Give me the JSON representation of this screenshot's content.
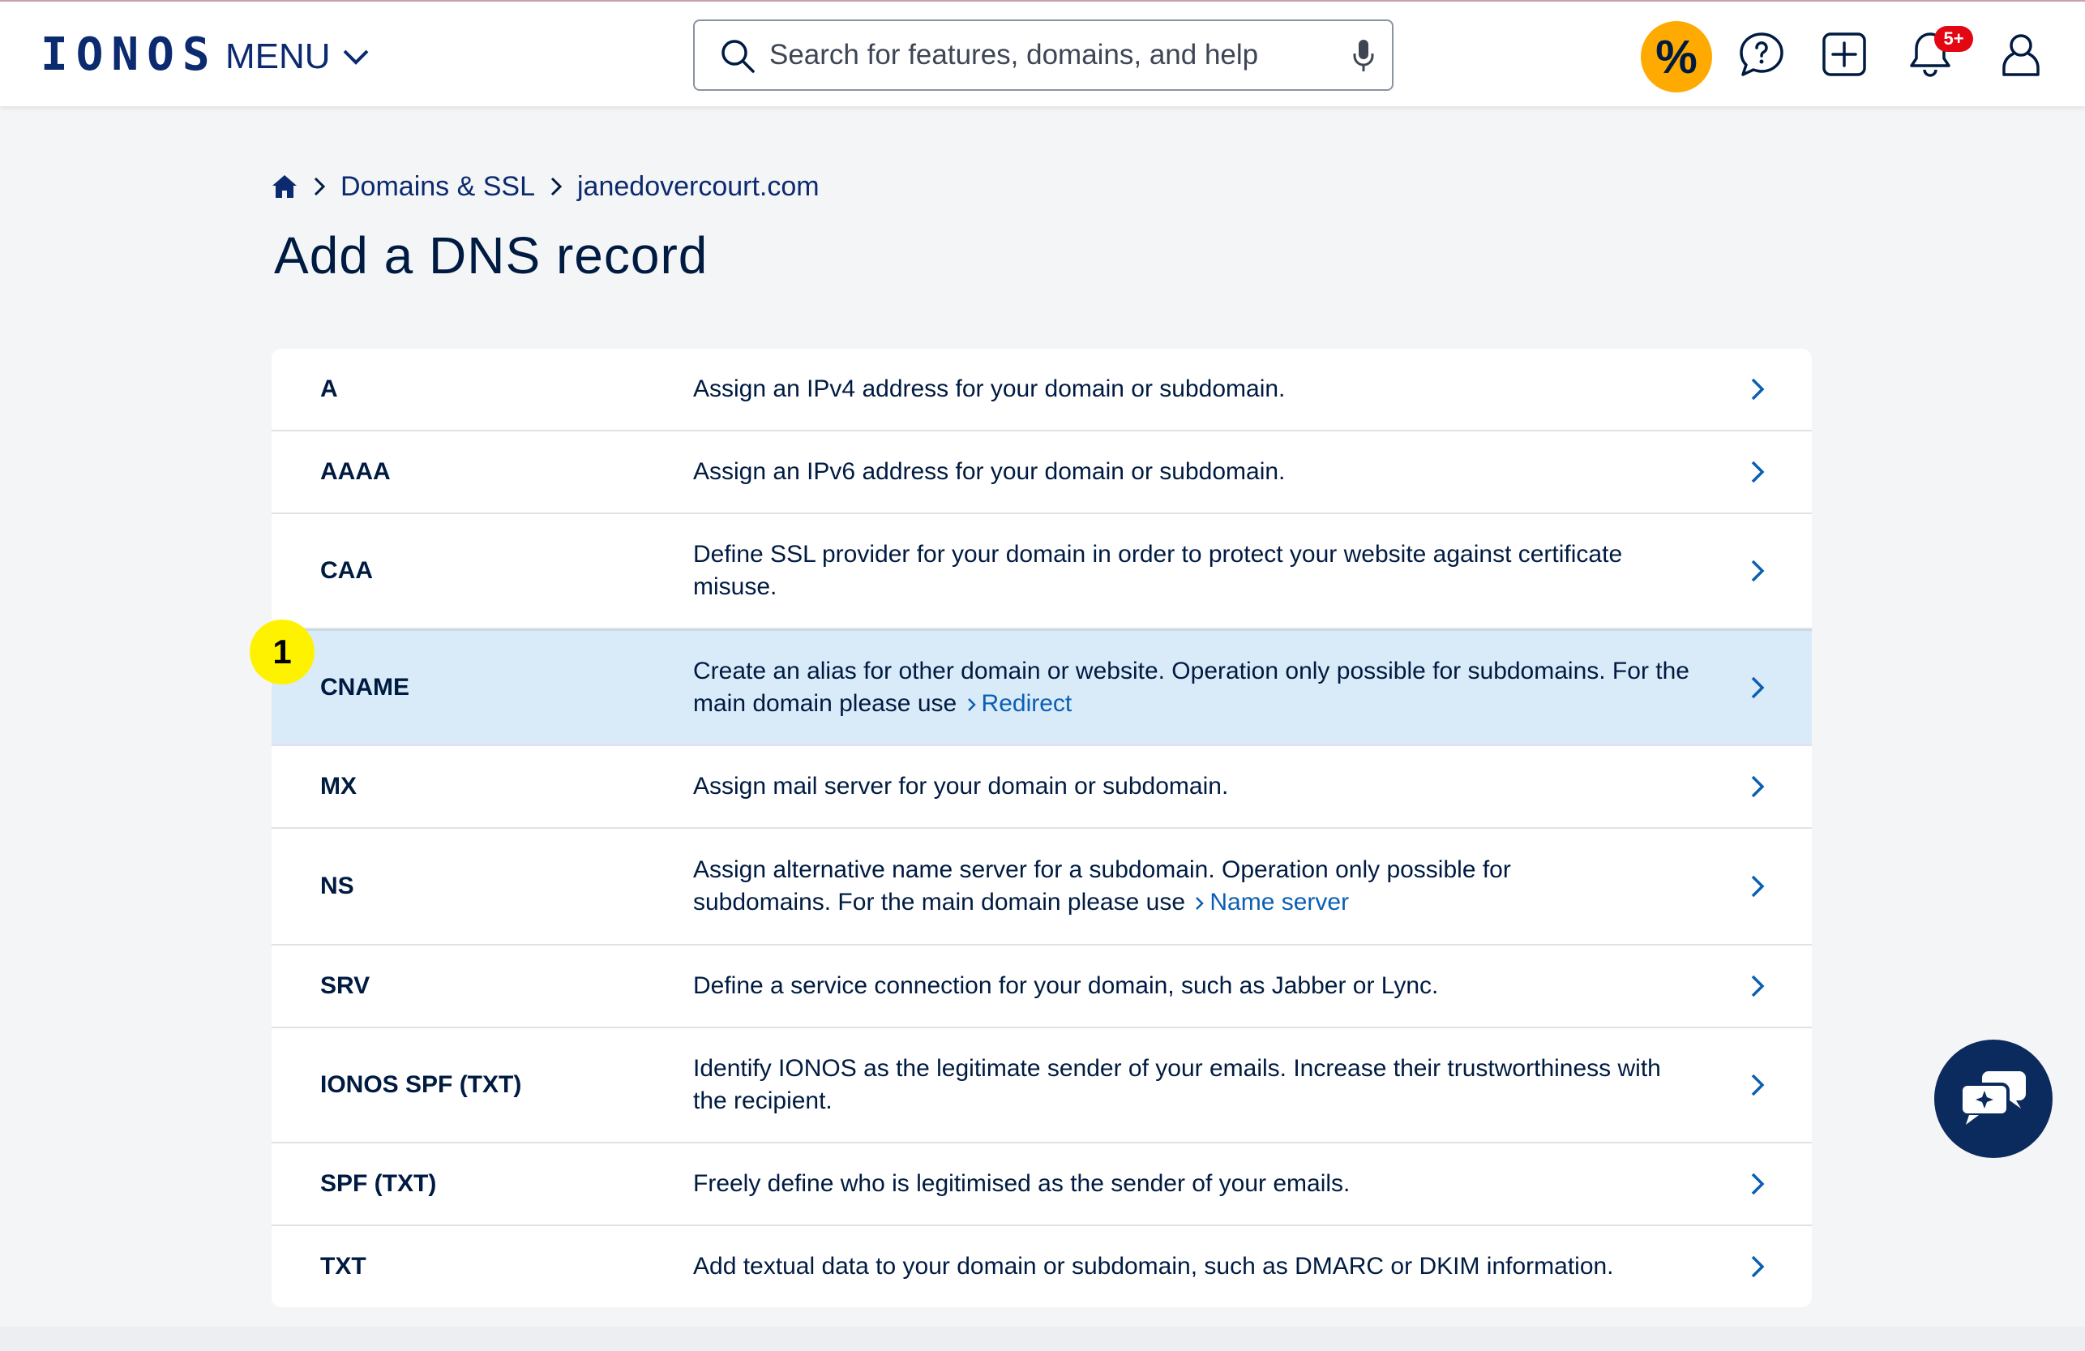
{
  "header": {
    "logo": "IONOS",
    "menu_label": "MENU",
    "search_placeholder": "Search for features, domains, and help",
    "promo_symbol": "%",
    "notification_badge": "5+",
    "icons": [
      "search-icon",
      "microphone-icon",
      "help-chat-icon",
      "add-icon",
      "bell-icon",
      "user-icon"
    ]
  },
  "breadcrumb": {
    "home_icon": "home-icon",
    "items": [
      "Domains & SSL",
      "janedovercourt.com"
    ]
  },
  "page": {
    "title": "Add a DNS record"
  },
  "records": [
    {
      "type": "A",
      "description": "Assign an IPv4 address for your domain or subdomain."
    },
    {
      "type": "AAAA",
      "description": "Assign an IPv6 address for your domain or subdomain."
    },
    {
      "type": "CAA",
      "description": "Define SSL provider for your domain in order to protect your website against certificate misuse."
    },
    {
      "type": "CNAME",
      "description": "Create an alias for other domain or website. Operation only possible for subdomains. For the main domain please use",
      "link": "Redirect"
    },
    {
      "type": "MX",
      "description": "Assign mail server for your domain or subdomain."
    },
    {
      "type": "NS",
      "description": "Assign alternative name server for a subdomain. Operation only possible for subdomains. For the main domain please use",
      "link": "Name server"
    },
    {
      "type": "SRV",
      "description": "Define a service connection for your domain, such as Jabber or Lync."
    },
    {
      "type": "IONOS SPF (TXT)",
      "description": "Identify IONOS as the legitimate sender of your emails. Increase their trustworthiness with the recipient."
    },
    {
      "type": "SPF (TXT)",
      "description": "Freely define who is legitimised as the sender of your emails."
    },
    {
      "type": "TXT",
      "description": "Add textual data to your domain or subdomain, such as DMARC or DKIM information."
    }
  ],
  "highlighted_record": "CNAME",
  "step_marker": "1",
  "colors": {
    "brand_navy": "#0b2a6f",
    "link_blue": "#0b5fb3",
    "promo_orange": "#ffaa00",
    "highlight_row": "#d9ebf8",
    "badge_red": "#e30613",
    "marker_yellow": "#fff200"
  }
}
